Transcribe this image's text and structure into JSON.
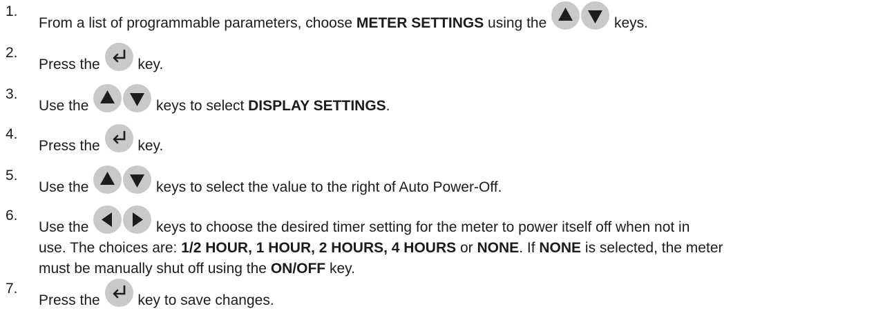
{
  "steps": [
    {
      "num": "1.",
      "pre": "From a list of programmable parameters, choose ",
      "bold": "METER SETTINGS",
      "post": " using the ",
      "post2": " keys.",
      "icons": [
        "up-arrow-key",
        "down-arrow-key"
      ]
    },
    {
      "num": "2.",
      "pre": "Press the ",
      "post": " key.",
      "icons": [
        "enter-key"
      ]
    },
    {
      "num": "3.",
      "pre": "Use the ",
      "mid": " keys to select ",
      "bold": "DISPLAY SETTINGS",
      "post": ".",
      "icons": [
        "up-arrow-key",
        "down-arrow-key"
      ]
    },
    {
      "num": "4.",
      "pre": "Press the ",
      "post": " key.",
      "icons": [
        "enter-key"
      ]
    },
    {
      "num": "5.",
      "pre": "Use the ",
      "post": " keys to select the value to the right of Auto Power-Off.",
      "icons": [
        "up-arrow-key",
        "down-arrow-key"
      ]
    },
    {
      "num": "6.",
      "pre": "Use the ",
      "post": " keys to choose the desired timer setting for the meter to power itself off when not in",
      "line2_a": "use. The choices are: ",
      "line2_b": "1/2 HOUR, 1 HOUR, 2 HOURS, 4 HOURS",
      "line2_c": " or ",
      "line2_d": "NONE",
      "line2_e": ". If ",
      "line2_f": "NONE",
      "line2_g": " is selected, the meter",
      "line3_a": "must be manually shut off using the ",
      "line3_b": "ON/OFF",
      "line3_c": " key.",
      "icons": [
        "left-arrow-key",
        "right-arrow-key"
      ]
    },
    {
      "num": "7.",
      "pre": "Press the ",
      "post": " key to save changes.",
      "icons": [
        "enter-key"
      ]
    }
  ],
  "colors": {
    "key_fill": "#c9c9c9",
    "glyph": "#1c1c1c",
    "text": "#1c1c1c"
  }
}
